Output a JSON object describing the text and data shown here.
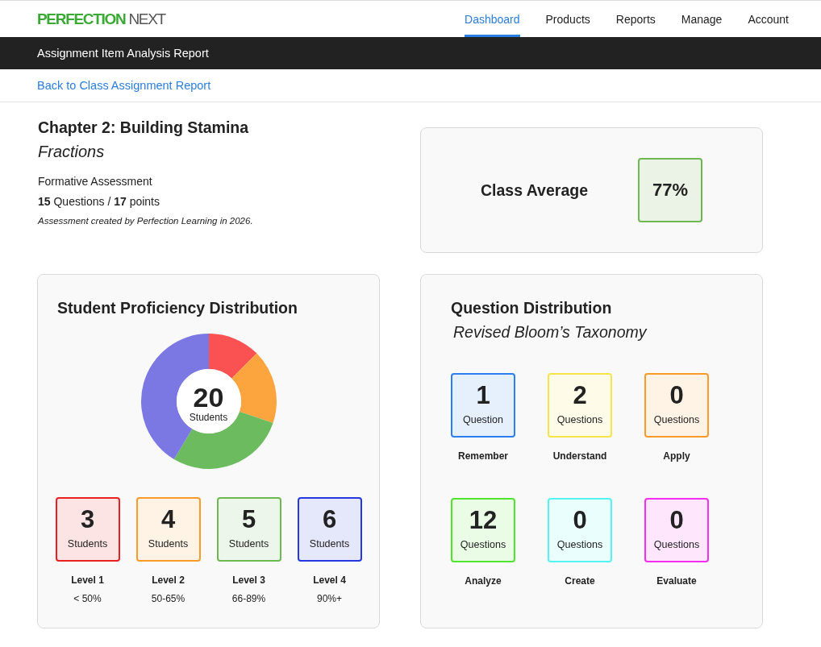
{
  "header": {
    "logo": {
      "brand": "PERFECTION",
      "suffix": "NEXT"
    },
    "nav": [
      {
        "label": "Dashboard",
        "selected": true
      },
      {
        "label": "Products",
        "selected": false
      },
      {
        "label": "Reports",
        "selected": false
      },
      {
        "label": "Manage",
        "selected": false
      },
      {
        "label": "Account",
        "selected": false
      }
    ]
  },
  "title_bar": {
    "title": "Assignment Item Analysis Report"
  },
  "back_link": {
    "label": "Back to Class Assignment Report"
  },
  "assignment": {
    "title": "Chapter 2: Building Stamina",
    "subtitle": "Fractions",
    "type": "Formative Assessment",
    "summary": "**15** Questions / **17** points",
    "credit": "Assessment created by Perfection Learning in 2026."
  },
  "class_average": {
    "label": "Class Average",
    "value": "77%"
  },
  "proficiency": {
    "title": "Student Proficiency Distribution",
    "total": "20",
    "total_label": "Students",
    "levels": [
      {
        "count": "3",
        "unit": "Students",
        "name": "Level 1",
        "range": "< 50%",
        "color": "#e82020"
      },
      {
        "count": "4",
        "unit": "Students",
        "name": "Level 2",
        "range": "50-65%",
        "color": "#f99a2a"
      },
      {
        "count": "5",
        "unit": "Students",
        "name": "Level 3",
        "range": "66-89%",
        "color": "#6db84f"
      },
      {
        "count": "6",
        "unit": "Students",
        "name": "Level 4",
        "range": "90%+",
        "color": "#2637e0"
      }
    ]
  },
  "questions": {
    "title": "Question Distribution",
    "subtitle": "Revised Bloom’s Taxonomy",
    "categories": [
      {
        "count": "1",
        "unit": "Question",
        "name": "Remember",
        "color": "#2b7ff0"
      },
      {
        "count": "2",
        "unit": "Questions",
        "name": "Understand",
        "color": "#f5e54a"
      },
      {
        "count": "0",
        "unit": "Questions",
        "name": "Apply",
        "color": "#fa9a2a"
      },
      {
        "count": "12",
        "unit": "Questions",
        "name": "Analyze",
        "color": "#4fe52c"
      },
      {
        "count": "0",
        "unit": "Questions",
        "name": "Create",
        "color": "#52f5f0"
      },
      {
        "count": "0",
        "unit": "Questions",
        "name": "Evaluate",
        "color": "#f52ef0"
      }
    ]
  }
}
